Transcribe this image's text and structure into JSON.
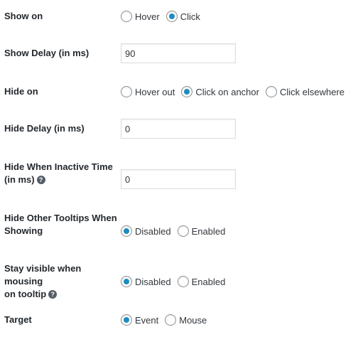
{
  "settings": {
    "show_on": {
      "label": "Show on",
      "options": [
        {
          "label": "Hover",
          "checked": false
        },
        {
          "label": "Click",
          "checked": true
        }
      ]
    },
    "show_delay": {
      "label": "Show Delay (in ms)",
      "value": "90"
    },
    "hide_on": {
      "label": "Hide on",
      "options": [
        {
          "label": "Hover out",
          "checked": false
        },
        {
          "label": "Click on anchor",
          "checked": true
        },
        {
          "label": "Click elsewhere",
          "checked": false
        }
      ]
    },
    "hide_delay": {
      "label": "Hide Delay (in ms)",
      "value": "0"
    },
    "hide_inactive": {
      "label_line1": "Hide When Inactive Time",
      "label_line2": "(in ms)",
      "help_icon": "?",
      "value": "0"
    },
    "hide_other": {
      "label_line1": "Hide Other Tooltips When",
      "label_line2": "Showing",
      "options": [
        {
          "label": "Disabled",
          "checked": true
        },
        {
          "label": "Enabled",
          "checked": false
        }
      ]
    },
    "stay_visible": {
      "label_line1": "Stay visible when mousing",
      "label_line2": "on tooltip",
      "help_icon": "?",
      "options": [
        {
          "label": "Disabled",
          "checked": true
        },
        {
          "label": "Enabled",
          "checked": false
        }
      ]
    },
    "target": {
      "label": "Target",
      "options": [
        {
          "label": "Event",
          "checked": true
        },
        {
          "label": "Mouse",
          "checked": false
        }
      ]
    }
  },
  "colors": {
    "radio_checked": "#1e8cbe",
    "help_icon_bg": "#555d66"
  }
}
